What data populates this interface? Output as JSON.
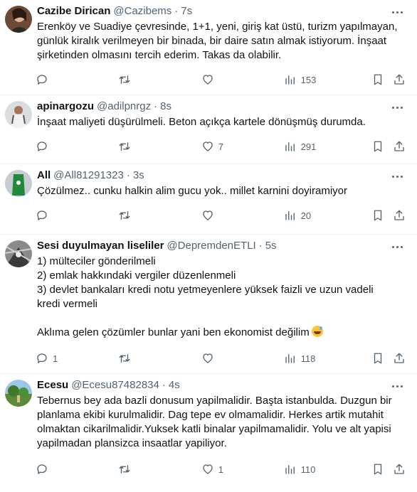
{
  "tweets": [
    {
      "name": "Cazibe Dirican",
      "handle": "@Cazibems",
      "separator": "·",
      "time": "7s",
      "lines": [
        "Erenköy ve Suadiye çevresinde, 1+1, yeni, giriş kat üstü, turizm yapılmayan,",
        "günlük kiralık verilmeyen bir binada, bir daire satın almak istiyorum. İnşaat",
        "şirketinden olmasını tercih ederim. Takas da olabilir."
      ],
      "replies": "",
      "retweets": "",
      "likes": "",
      "views": "153"
    },
    {
      "name": "apinargozu",
      "handle": "@adilpnrgz",
      "separator": "·",
      "time": "8s",
      "lines": [
        "İnşaat maliyeti düşürülmeli. Beton açıkça kartele dönüşmüş durumda."
      ],
      "replies": "",
      "retweets": "",
      "likes": "7",
      "views": "291"
    },
    {
      "name": "All",
      "handle": "@All81291323",
      "separator": "·",
      "time": "3s",
      "lines": [
        "Çözülmez.. cunku halkin alim gucu yok.. millet karnini doyiramiyor"
      ],
      "replies": "",
      "retweets": "",
      "likes": "",
      "views": "20"
    },
    {
      "name": "Sesi duyulmayan liseliler",
      "handle": "@DepremdenETLI",
      "separator": "·",
      "time": "5s",
      "lines": [
        "1) mülteciler gönderilmeli",
        "2) emlak hakkındaki vergiler düzenlenmeli",
        "3) devlet bankaları kredi notu yetmeyenlere yüksek faizli ve uzun vadeli",
        "kredi vermeli",
        "",
        "Aklıma gelen çözümler bunlar yani ben ekonomist değilim"
      ],
      "emoji": "sweat-smile-emoji",
      "replies": "1",
      "retweets": "",
      "likes": "",
      "views": "118"
    },
    {
      "name": "Ecesu",
      "handle": "@Ecesu87482834",
      "separator": "·",
      "time": "4s",
      "lines": [
        "Tebernus bey ada bazli donusum yapilmalidir. Başta istanbulda. Duzgun bir",
        "planlama ekibi kurulmalidir. Dag tepe ev olmamalidir.  Herkes artik mutahit",
        "olmaktan cikarilmalidir.Yuksek katli binalar yapilmamalidir. Yolu ve alt yapisi",
        "yapilmadan plansizca insaatlar yapiliyor."
      ],
      "replies": "",
      "retweets": "",
      "likes": "1",
      "views": "110"
    }
  ],
  "icons": {
    "reply": "reply-icon",
    "retweet": "retweet-icon",
    "like": "heart-icon",
    "views": "views-icon",
    "bookmark": "bookmark-icon",
    "share": "share-icon",
    "more": "more-icon"
  },
  "colors": {
    "text": "#0f1419",
    "secondary": "#536471",
    "divider": "#eff3f4"
  }
}
